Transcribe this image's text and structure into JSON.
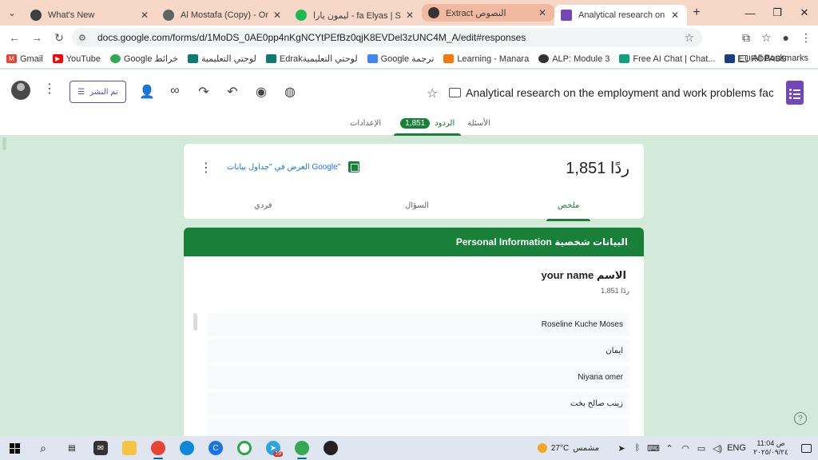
{
  "browser": {
    "tabs": [
      {
        "title": "What's New",
        "fav": "#3c4043"
      },
      {
        "title": "Al Mostafa (Copy) - Online I",
        "fav": "#5f6368"
      },
      {
        "title": "ليمون يارا - fa Elyas | Spotify",
        "fav": "#1db954"
      },
      {
        "title": "Extract النصوص",
        "fav": "#333333"
      },
      {
        "title": "Analytical research on the e",
        "fav": "#7248b9"
      }
    ],
    "url": "docs.google.com/forms/d/1MoDS_0AE0pp4nKgNCYtPEfBz0qjK8EVDel3zUNC4M_A/edit#responses",
    "bookmarks": [
      {
        "label": "Gmail",
        "color": "#ea4335"
      },
      {
        "label": "YouTube",
        "color": "#ff0000"
      },
      {
        "label": "Google خرائط",
        "color": "#34a853"
      },
      {
        "label": "لوحتي التعليمية",
        "color": "#0a7c6f"
      },
      {
        "label": "Edrakلوحتي التعليمية",
        "color": "#0a7c6f"
      },
      {
        "label": "Google ترجمة",
        "color": "#4285f4"
      },
      {
        "label": "Learning - Manara",
        "color": "#f57c00"
      },
      {
        "label": "ALP: Module 3",
        "color": "#333333"
      },
      {
        "label": "Free AI Chat | Chat...",
        "color": "#10a37f"
      },
      {
        "label": "EUROPASS",
        "color": "#1a3d8f"
      }
    ],
    "more": "»",
    "all_bookmarks": "All Bookmarks"
  },
  "form": {
    "publish_label": "تم النشر",
    "title": "Analytical research on the employment and work problems facir",
    "tabs": {
      "questions": "الأسئلة",
      "responses": "الردود",
      "responses_count": "1,851",
      "settings": "الإعدادات"
    }
  },
  "summary": {
    "count": "1,851 ردًا",
    "sheets_link": "العرض في \"جداول بيانات Google\"",
    "subtabs": {
      "summary": "ملخص",
      "question": "السؤال",
      "individual": "فردي"
    }
  },
  "section": {
    "title": "Personal Information البيانات شخصية",
    "question": "your name الاسم",
    "response_count": "1,851 ردًا",
    "answers": [
      "Roseline Kuche Moses",
      "ايمان",
      "Niyana omer",
      "زينب صالح بخت",
      ""
    ]
  },
  "taskbar": {
    "weather_temp": "27°C",
    "weather_label": "مشمس",
    "lang": "ENG",
    "time": "11:04 ص",
    "date": "٢٠٢٥/٠٩/٢٤",
    "badge": "19"
  }
}
